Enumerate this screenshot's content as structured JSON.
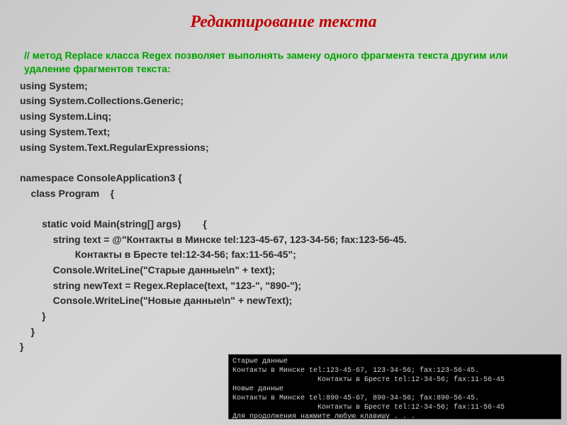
{
  "title": "Редактирование текста",
  "comment": " // метод Replace класса Regex позволяет выполнять замену одного фрагмента\n    текста другим или удаление фрагментов текста:",
  "code": "using System;\nusing System.Collections.Generic;\nusing System.Linq;\nusing System.Text;\nusing System.Text.RegularExpressions;\n\nnamespace ConsoleApplication3 {\n    class Program    {\n\n        static void Main(string[] args)        {\n            string text = @\"Контакты в Минске tel:123-45-67, 123-34-56; fax:123-56-45.\n                    Контакты в Бресте tel:12-34-56; fax:11-56-45\";\n            Console.WriteLine(\"Старые данные\\n\" + text);\n            string newText = Regex.Replace(text, \"123-\", \"890-\");\n            Console.WriteLine(\"Новые данные\\n\" + newText);\n        }\n    }\n}",
  "console_output": "Старые данные\nКонтакты в Минске tel:123-45-67, 123-34-56; fax:123-56-45.\n                    Контакты в Бресте tel:12-34-56; fax:11-56-45\nНовые данные\nКонтакты в Минске tel:890-45-67, 890-34-56; fax:890-56-45.\n                    Контакты в Бресте tel:12-34-56; fax:11-56-45\nДля продолжения нажмите любую клавишу . . ."
}
